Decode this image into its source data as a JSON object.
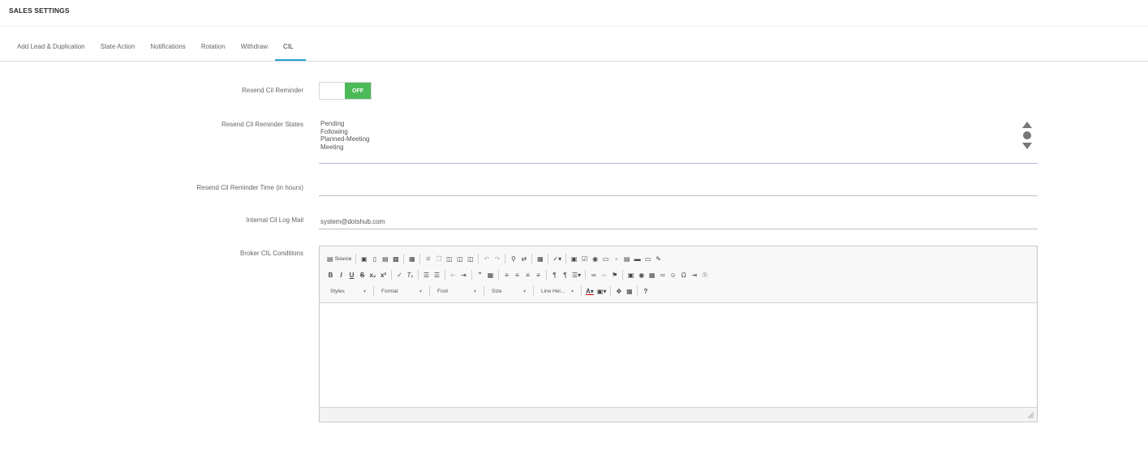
{
  "page": {
    "title": "SALES SETTINGS"
  },
  "tabs": [
    {
      "label": "Add Lead & Duplication"
    },
    {
      "label": "State Action"
    },
    {
      "label": "Notifications"
    },
    {
      "label": "Rotation"
    },
    {
      "label": "Withdraw"
    },
    {
      "label": "CIL"
    }
  ],
  "active_tab": "CIL",
  "colors": {
    "accent": "#29a3cf",
    "toggle_off": "#4cba59",
    "select_underline": "#b9b6d9"
  },
  "form": {
    "reminder": {
      "label": "Resend Cil Reminder",
      "toggle_value": "OFF"
    },
    "states": {
      "label": "Resend Cil Reminder States",
      "options": [
        "Pending",
        "Following",
        "Planned-Meeting",
        "Meeting"
      ]
    },
    "time": {
      "label": "Resend Cil Reminder Time (in hours)",
      "value": ""
    },
    "mail": {
      "label": "Internal Cil Log Mail",
      "value": "system@dotshub.com"
    },
    "conditions": {
      "label": "Broker CIL Conditions"
    }
  },
  "editor": {
    "source_label": "Source",
    "styles_label": "Styles",
    "format_label": "Format",
    "font_label": "Font",
    "size_label": "Size",
    "lineheight_label": "Line Hei...",
    "help_label": "?",
    "content": ""
  }
}
